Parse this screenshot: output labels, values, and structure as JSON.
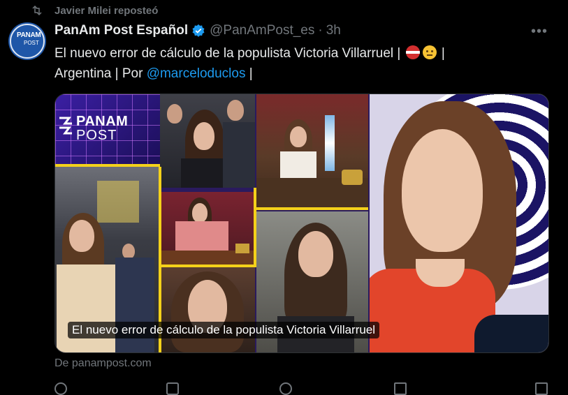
{
  "repost": {
    "icon": "repost-icon",
    "text": "Javier Milei reposteó"
  },
  "tweet": {
    "author_name": "PanAm Post Español",
    "verified_icon": "verified-badge-icon",
    "handle": "@PanAmPost_es",
    "separator": "·",
    "time": "3h",
    "text_main": "El nuevo error de cálculo de la populista Victoria Villarruel |",
    "text_sep": "|",
    "text_line2_prefix": "Argentina | Por ",
    "mention": "@marceloduclos",
    "text_line2_suffix": " |",
    "emojis": [
      "austria-flag-emoji",
      "thinking-face-emoji"
    ]
  },
  "avatar": {
    "line1": "PANAM",
    "line2": "POST"
  },
  "card": {
    "logo_line1": "PANAM",
    "logo_line2": "POST",
    "caption": "El nuevo error de cálculo de la populista Victoria Villarruel"
  },
  "source": "De panampost.com",
  "colors": {
    "background": "#000000",
    "text": "#e7e9ea",
    "muted": "#71767b",
    "link": "#1d9bf0",
    "verified": "#1d9bf0",
    "accent_yellow": "#f4d11a"
  }
}
